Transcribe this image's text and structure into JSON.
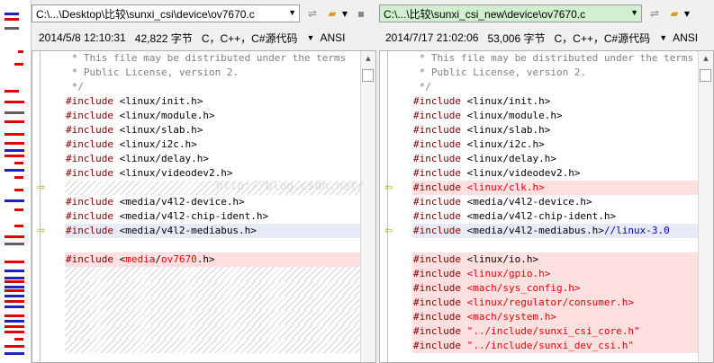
{
  "left": {
    "path": "C:\\...\\Desktop\\比较\\sunxi_csi\\device\\ov7670.c",
    "date": "2014/5/8 12:10:31",
    "size": "42,822 字节",
    "lang": "C，C++，C#源代码",
    "encoding": "ANSI",
    "lines": [
      {
        "type": "cmt",
        "text": " * This file may be distributed under the terms"
      },
      {
        "type": "cmt",
        "text": " * Public License, version 2."
      },
      {
        "type": "cmt",
        "text": " */"
      },
      {
        "type": "inc",
        "kw": "#include",
        "arg": " <linux/init.h>"
      },
      {
        "type": "inc",
        "kw": "#include",
        "arg": " <linux/module.h>"
      },
      {
        "type": "inc",
        "kw": "#include",
        "arg": " <linux/slab.h>"
      },
      {
        "type": "inc",
        "kw": "#include",
        "arg": " <linux/i2c.h>"
      },
      {
        "type": "inc",
        "kw": "#include",
        "arg": " <linux/delay.h>"
      },
      {
        "type": "inc",
        "kw": "#include",
        "arg": " <linux/videodev2.h>"
      },
      {
        "type": "hatch"
      },
      {
        "type": "inc",
        "kw": "#include",
        "arg": " <media/v4l2-device.h>"
      },
      {
        "type": "inc",
        "kw": "#include",
        "arg": " <media/v4l2-chip-ident.h>"
      },
      {
        "type": "mod",
        "kw": "#include",
        "arg": " <media/v4l2-mediabus.h>"
      },
      {
        "type": "blank"
      },
      {
        "type": "diffsplit",
        "kw": "#include",
        "pre": " <",
        "red": "media",
        "mid": "/",
        "red2": "ov7670",
        "post": ".h>"
      },
      {
        "type": "hatch"
      },
      {
        "type": "hatch"
      },
      {
        "type": "hatch"
      },
      {
        "type": "hatch"
      },
      {
        "type": "hatch"
      },
      {
        "type": "hatch"
      }
    ]
  },
  "right": {
    "path": "C:\\...\\比较\\sunxi_csi_new\\device\\ov7670.c",
    "date": "2014/7/17 21:02:06",
    "size": "53,006 字节",
    "lang": "C，C++，C#源代码",
    "encoding": "ANSI",
    "lines": [
      {
        "type": "cmt",
        "text": " * This file may be distributed under the terms"
      },
      {
        "type": "cmt",
        "text": " * Public License, version 2."
      },
      {
        "type": "cmt",
        "text": " */"
      },
      {
        "type": "inc",
        "kw": "#include",
        "arg": " <linux/init.h>"
      },
      {
        "type": "inc",
        "kw": "#include",
        "arg": " <linux/module.h>"
      },
      {
        "type": "inc",
        "kw": "#include",
        "arg": " <linux/slab.h>"
      },
      {
        "type": "inc",
        "kw": "#include",
        "arg": " <linux/i2c.h>"
      },
      {
        "type": "inc",
        "kw": "#include",
        "arg": " <linux/delay.h>"
      },
      {
        "type": "inc",
        "kw": "#include",
        "arg": " <linux/videodev2.h>"
      },
      {
        "type": "diff",
        "kw": "#include",
        "arg": " <linux/clk.h>"
      },
      {
        "type": "inc",
        "kw": "#include",
        "arg": " <media/v4l2-device.h>"
      },
      {
        "type": "inc",
        "kw": "#include",
        "arg": " <media/v4l2-chip-ident.h>"
      },
      {
        "type": "modc",
        "kw": "#include",
        "arg": " <media/v4l2-mediabus.h>",
        "comment": "//linux-3.0"
      },
      {
        "type": "blank"
      },
      {
        "type": "diffblack",
        "kw": "#include",
        "arg": " <linux/io.h>"
      },
      {
        "type": "diff",
        "kw": "#include",
        "arg": " <linux/gpio.h>"
      },
      {
        "type": "diff",
        "kw": "#include",
        "arg": " <mach/sys_config.h>"
      },
      {
        "type": "diff",
        "kw": "#include",
        "arg": " <linux/regulator/consumer.h>"
      },
      {
        "type": "diff",
        "kw": "#include",
        "arg": " <mach/system.h>"
      },
      {
        "type": "diff",
        "kw": "#include",
        "arg": " \"../include/sunxi_csi_core.h\""
      },
      {
        "type": "diff",
        "kw": "#include",
        "arg": " \"../include/sunxi_dev_csi.h\""
      }
    ]
  },
  "watermark": "http://blog.csdn.net/"
}
